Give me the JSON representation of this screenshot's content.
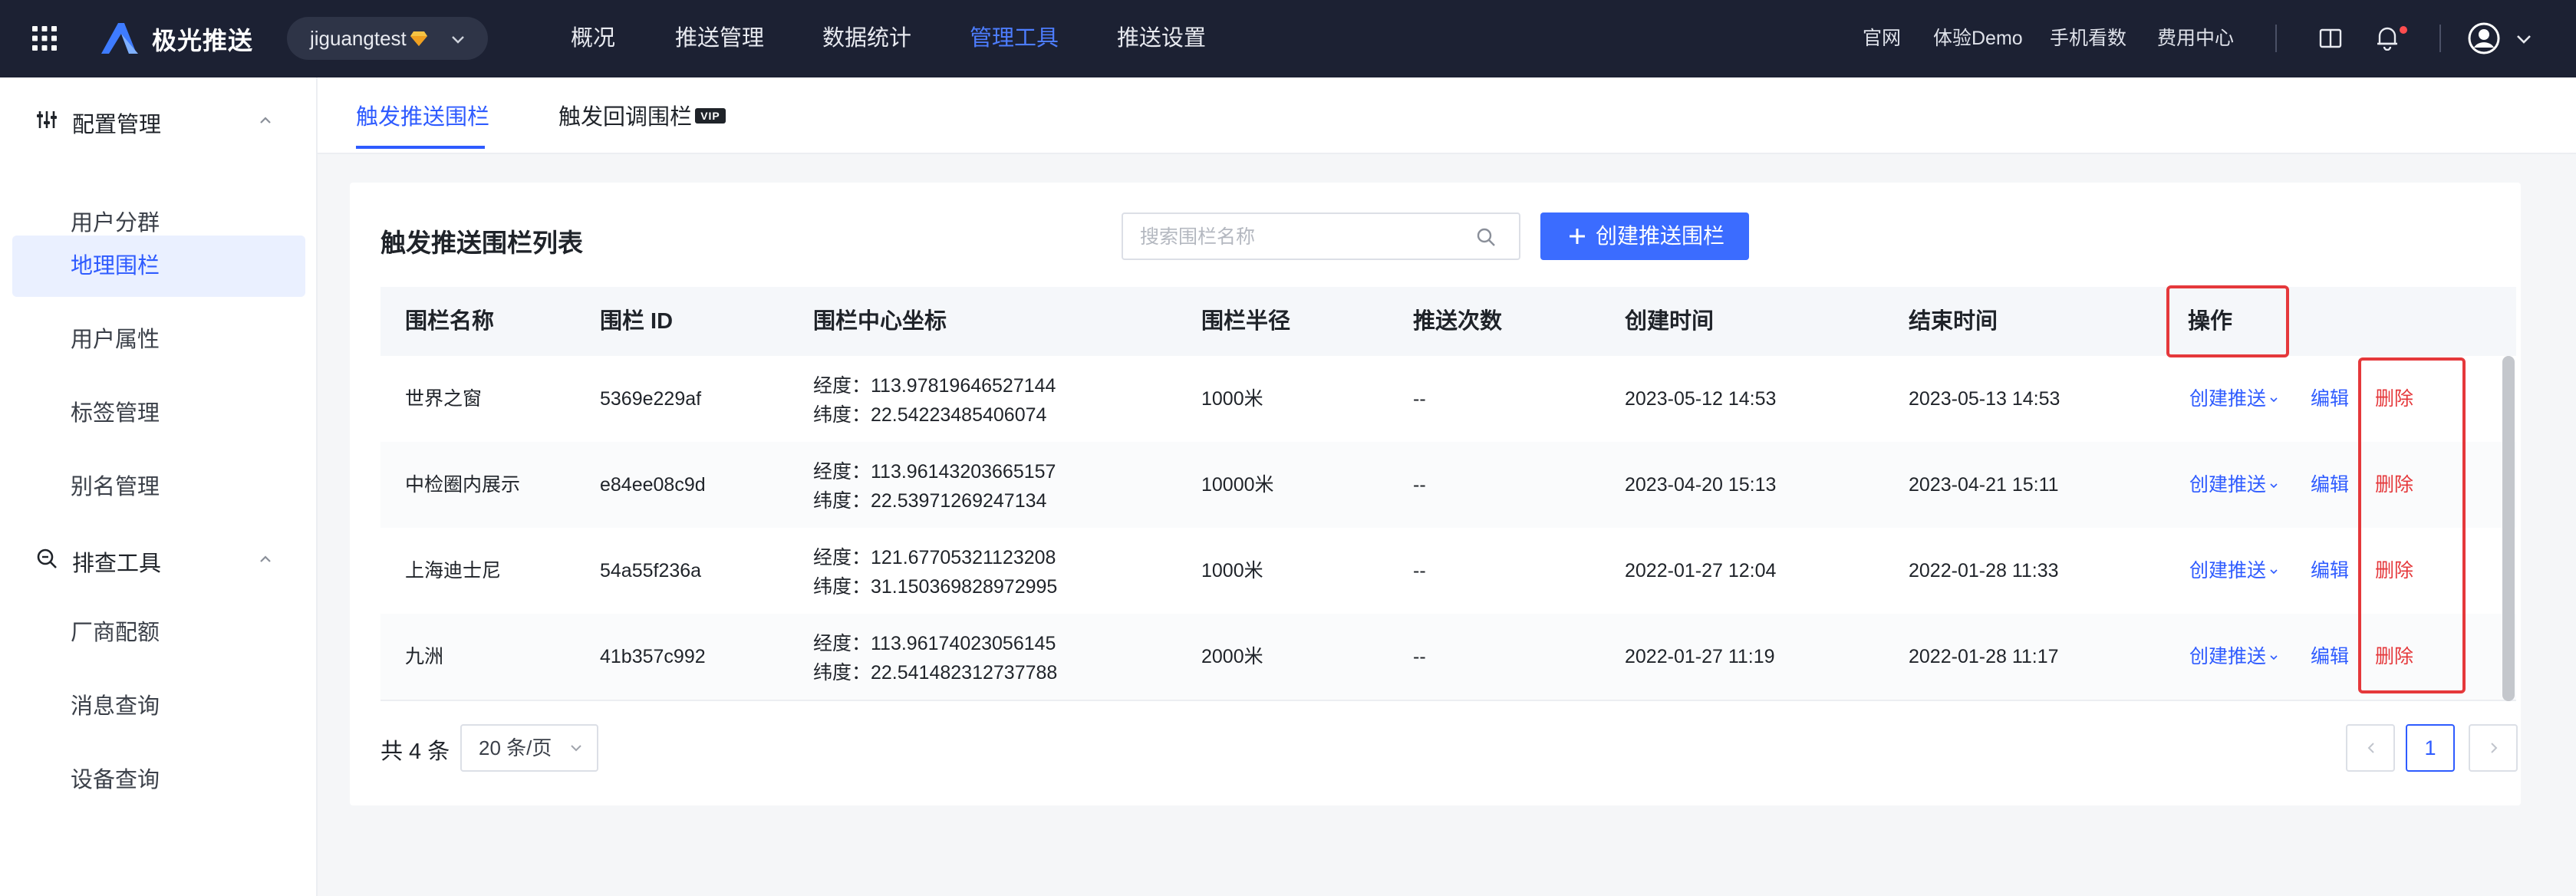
{
  "topbar": {
    "brand": "极光推送",
    "app_name": "jiguangtest",
    "nav": [
      "概况",
      "推送管理",
      "数据统计",
      "管理工具",
      "推送设置"
    ],
    "active_nav": "管理工具",
    "right_links": [
      "官网",
      "体验Demo",
      "手机看数",
      "费用中心"
    ]
  },
  "sidebar": {
    "groups": [
      {
        "label": "配置管理",
        "items": [
          "用户分群",
          "地理围栏",
          "用户属性",
          "标签管理",
          "别名管理"
        ]
      },
      {
        "label": "排查工具",
        "items": [
          "厂商配额",
          "消息查询",
          "设备查询"
        ]
      }
    ],
    "active_item": "地理围栏"
  },
  "subtabs": {
    "tabs": [
      "触发推送围栏",
      "触发回调围栏"
    ],
    "vip_badge": "VIP",
    "active": "触发推送围栏"
  },
  "card": {
    "title": "触发推送围栏列表",
    "search_placeholder": "搜索围栏名称",
    "create_button": "创建推送围栏"
  },
  "table": {
    "columns": [
      "围栏名称",
      "围栏 ID",
      "围栏中心坐标",
      "围栏半径",
      "推送次数",
      "创建时间",
      "结束时间",
      "操作"
    ],
    "rows": [
      {
        "name": "世界之窗",
        "id": "5369e229af",
        "lng": "经度：113.97819646527144",
        "lat": "纬度：22.54223485406074",
        "radius": "1000米",
        "count": "--",
        "created": "2023-05-12 14:53",
        "ended": "2023-05-13 14:53"
      },
      {
        "name": "中检圈内展示",
        "id": "e84ee08c9d",
        "lng": "经度：113.96143203665157",
        "lat": "纬度：22.53971269247134",
        "radius": "10000米",
        "count": "--",
        "created": "2023-04-20 15:13",
        "ended": "2023-04-21 15:11"
      },
      {
        "name": "上海迪士尼",
        "id": "54a55f236a",
        "lng": "经度：121.67705321123208",
        "lat": "纬度：31.150369828972995",
        "radius": "1000米",
        "count": "--",
        "created": "2022-01-27 12:04",
        "ended": "2022-01-28 11:33"
      },
      {
        "name": "九洲",
        "id": "41b357c992",
        "lng": "经度：113.96174023056145",
        "lat": "纬度：22.541482312737788",
        "radius": "2000米",
        "count": "--",
        "created": "2022-01-27 11:19",
        "ended": "2022-01-28 11:17"
      }
    ],
    "actions": {
      "push": "创建推送",
      "edit": "编辑",
      "delete": "删除"
    }
  },
  "footer": {
    "total": "共 4 条",
    "page_size": "20 条/页",
    "current_page": "1"
  },
  "colors": {
    "accent": "#2e5bff",
    "danger": "#e5383b",
    "topbar": "#1c2133"
  }
}
